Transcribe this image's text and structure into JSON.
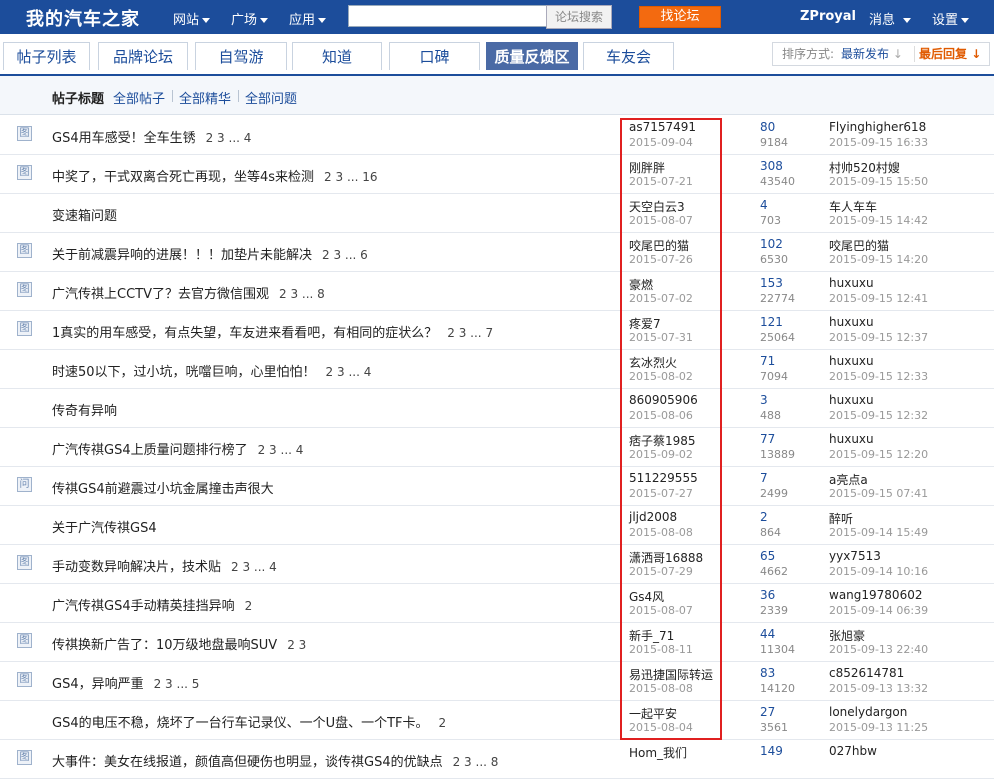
{
  "header": {
    "logo": "我的汽车之家",
    "nav": [
      "网站",
      "广场",
      "应用"
    ],
    "search_placeholder": "",
    "search_button": "论坛搜索",
    "find_button": "找论坛",
    "username": "ZProyal",
    "messages": "消息",
    "settings": "设置",
    "accent": "#1c4d9b",
    "find_color": "#f36a10"
  },
  "tabs": [
    {
      "label": "帖子列表",
      "active": false
    },
    {
      "label": "品牌论坛",
      "active": false
    },
    {
      "label": "自驾游",
      "active": false
    },
    {
      "label": "知道",
      "active": false
    },
    {
      "label": "口碑",
      "active": false
    },
    {
      "label": "质量反馈区",
      "active": true
    },
    {
      "label": "车友会",
      "active": false
    }
  ],
  "sort": {
    "label": "排序方式:",
    "option1": "最新发布",
    "option2": "最后回复"
  },
  "filter": {
    "title": "帖子标题",
    "links": [
      "全部帖子",
      "全部精华",
      "全部问题"
    ]
  },
  "posts": [
    {
      "icon": "图",
      "title": "GS4用车感受！全车生锈",
      "pages": "2 3 ... 4",
      "author": "as7157491",
      "date": "2015-09-04",
      "replies": "80",
      "views": "9184",
      "last_user": "Flyinghigher618",
      "last_time": "2015-09-15 16:33"
    },
    {
      "icon": "图",
      "title": "中奖了，干式双离合死亡再现，坐等4s来检测",
      "pages": "2 3 ... 16",
      "author": "刚胖胖",
      "date": "2015-07-21",
      "replies": "308",
      "views": "43540",
      "last_user": "村帅520村嫂",
      "last_time": "2015-09-15 15:50"
    },
    {
      "icon": "",
      "title": "变速箱问题",
      "pages": "",
      "author": "天空白云3",
      "date": "2015-08-07",
      "replies": "4",
      "views": "703",
      "last_user": "车人车车",
      "last_time": "2015-09-15 14:42"
    },
    {
      "icon": "图",
      "title": "关于前减震异响的进展！！！加垫片未能解决",
      "pages": "2 3 ... 6",
      "author": "咬尾巴的猫",
      "date": "2015-07-26",
      "replies": "102",
      "views": "6530",
      "last_user": "咬尾巴的猫",
      "last_time": "2015-09-15 14:20"
    },
    {
      "icon": "图",
      "title": "广汽传祺上CCTV了？去官方微信围观",
      "pages": "2 3 ... 8",
      "author": "豪燃",
      "date": "2015-07-02",
      "replies": "153",
      "views": "22774",
      "last_user": "huxuxu",
      "last_time": "2015-09-15 12:41"
    },
    {
      "icon": "图",
      "title": "1真实的用车感受，有点失望，车友进来看看吧，有相同的症状么？",
      "pages": "2 3 ... 7",
      "author": "疼爱7",
      "date": "2015-07-31",
      "replies": "121",
      "views": "25064",
      "last_user": "huxuxu",
      "last_time": "2015-09-15 12:37"
    },
    {
      "icon": "",
      "title": "时速50以下，过小坑，咣噹巨响，心里怕怕！",
      "pages": "2 3 ... 4",
      "author": "玄冰烈火",
      "date": "2015-08-02",
      "replies": "71",
      "views": "7094",
      "last_user": "huxuxu",
      "last_time": "2015-09-15 12:33"
    },
    {
      "icon": "",
      "title": "传奇有异响",
      "pages": "",
      "author": "860905906",
      "date": "2015-08-06",
      "replies": "3",
      "views": "488",
      "last_user": "huxuxu",
      "last_time": "2015-09-15 12:32"
    },
    {
      "icon": "",
      "title": "广汽传祺GS4上质量问题排行榜了",
      "pages": "2 3 ... 4",
      "author": "痞子蔡1985",
      "date": "2015-09-02",
      "replies": "77",
      "views": "13889",
      "last_user": "huxuxu",
      "last_time": "2015-09-15 12:20"
    },
    {
      "icon": "问",
      "title": "传祺GS4前避震过小坑金属撞击声很大",
      "pages": "",
      "author": "511229555",
      "date": "2015-07-27",
      "replies": "7",
      "views": "2499",
      "last_user": "a亮点a",
      "last_time": "2015-09-15 07:41"
    },
    {
      "icon": "",
      "title": "关于广汽传祺GS4",
      "pages": "",
      "author": "jljd2008",
      "date": "2015-08-08",
      "replies": "2",
      "views": "864",
      "last_user": "醉听",
      "last_time": "2015-09-14 15:49"
    },
    {
      "icon": "图",
      "title": "手动变数异响解决片，技术贴",
      "pages": "2 3 ... 4",
      "author": "潇洒哥16888",
      "date": "2015-07-29",
      "replies": "65",
      "views": "4662",
      "last_user": "yyx7513",
      "last_time": "2015-09-14 10:16"
    },
    {
      "icon": "",
      "title": "广汽传祺GS4手动精英挂挡异响",
      "pages": "2",
      "author": "Gs4风",
      "date": "2015-08-07",
      "replies": "36",
      "views": "2339",
      "last_user": "wang19780602",
      "last_time": "2015-09-14 06:39"
    },
    {
      "icon": "图",
      "title": "传祺换新广告了：10万级地盘最响SUV",
      "pages": "2 3",
      "author": "新手_71",
      "date": "2015-08-11",
      "replies": "44",
      "views": "11304",
      "last_user": "张旭豪",
      "last_time": "2015-09-13 22:40"
    },
    {
      "icon": "图",
      "title": "GS4，异响严重",
      "pages": "2 3 ... 5",
      "author": "易迅捷国际转运",
      "date": "2015-08-08",
      "replies": "83",
      "views": "14120",
      "last_user": "c852614781",
      "last_time": "2015-09-13 13:32"
    },
    {
      "icon": "",
      "title": "GS4的电压不稳，烧坏了一台行车记录仪、一个U盘、一个TF卡。",
      "pages": "2",
      "author": "一起平安",
      "date": "2015-08-04",
      "replies": "27",
      "views": "3561",
      "last_user": "lonelydargon",
      "last_time": "2015-09-13 11:25"
    },
    {
      "icon": "图",
      "title": "大事件：美女在线报道，颜值高但硬伤也明显，谈传祺GS4的优缺点",
      "pages": "2 3 ... 8",
      "author": "Hom_我们",
      "date": "",
      "replies": "149",
      "views": "",
      "last_user": "027hbw",
      "last_time": ""
    }
  ]
}
